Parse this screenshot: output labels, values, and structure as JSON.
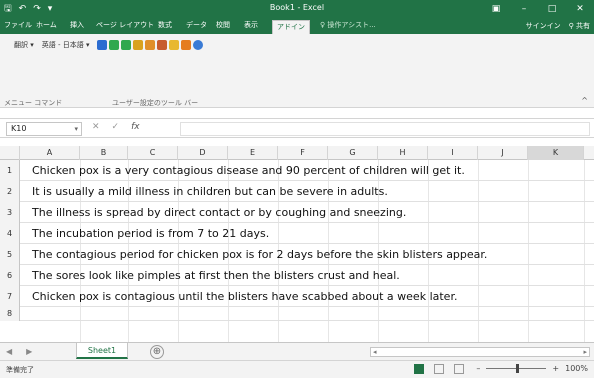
{
  "titlebar": {
    "title": "Book1 - Excel",
    "qat": {
      "save": "🖫",
      "undo": "↶",
      "redo": "↷",
      "extra": "▾"
    },
    "winbtns": {
      "restore": "▣",
      "minimize": "–",
      "maximize": "□",
      "close": "✕"
    }
  },
  "tabs": {
    "items": [
      "ファイル",
      "ホーム",
      "挿入",
      "ページ レイアウト",
      "数式",
      "データ",
      "校閲",
      "表示",
      "アドイン"
    ],
    "active_index": 8,
    "tell_me": "操作アシスト...",
    "signin": "サインイン",
    "share": "共有"
  },
  "ribbon": {
    "translate_btn": "翻訳",
    "lang_select": "英語 - 日本語",
    "group1_label": "メニュー コマンド",
    "group2_label": "ユーザー設定のツール バー"
  },
  "formula_bar": {
    "name_box": "K10",
    "fx": "fx",
    "value": ""
  },
  "columns": [
    "A",
    "B",
    "C",
    "D",
    "E",
    "F",
    "G",
    "H",
    "I",
    "J",
    "K"
  ],
  "selected_column": "K",
  "rows": [
    {
      "n": "1",
      "text": "Chicken pox is a very contagious disease and 90 percent of children will get it."
    },
    {
      "n": "2",
      "text": "It is usually a mild illness in children but can be severe in adults."
    },
    {
      "n": "3",
      "text": "The illness is spread by direct contact or by coughing and sneezing."
    },
    {
      "n": "4",
      "text": "The incubation period is from 7 to 21 days."
    },
    {
      "n": "5",
      "text": "The contagious period for chicken pox is for 2 days before the skin blisters appear."
    },
    {
      "n": "6",
      "text": "The sores look like pimples at first then the blisters crust and heal."
    },
    {
      "n": "7",
      "text": "Chicken pox is contagious until the blisters have scabbed about a week later."
    },
    {
      "n": "8",
      "text": ""
    }
  ],
  "sheet_tabs": {
    "active": "Sheet1",
    "add_icon": "⊕"
  },
  "status": {
    "ready": "準備完了",
    "zoom": "100%"
  },
  "colors": {
    "accent": "#217346"
  }
}
